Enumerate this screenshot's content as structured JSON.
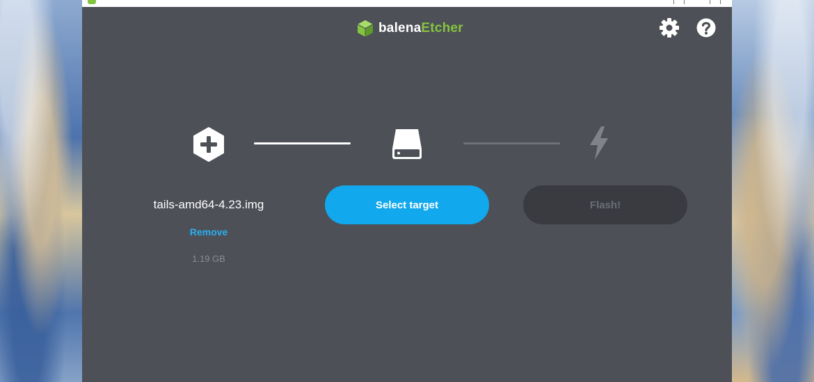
{
  "app": {
    "brand_prefix": "balena",
    "brand_suffix": "Etcher",
    "brand_color": "#85c440"
  },
  "header": {
    "settings_icon": "gear-icon",
    "help_icon": "help-icon"
  },
  "steps": {
    "image": {
      "icon": "plus-hexagon-icon",
      "filename": "tails-amd64-4.23.img",
      "remove_label": "Remove",
      "size": "1.19 GB"
    },
    "target": {
      "icon": "drive-icon",
      "button_label": "Select target",
      "button_color": "#11a8ed"
    },
    "flash": {
      "icon": "lightning-icon",
      "button_label": "Flash!",
      "enabled": false
    }
  },
  "colors": {
    "window_bg": "#4d5057",
    "accent": "#2ab0f2"
  }
}
